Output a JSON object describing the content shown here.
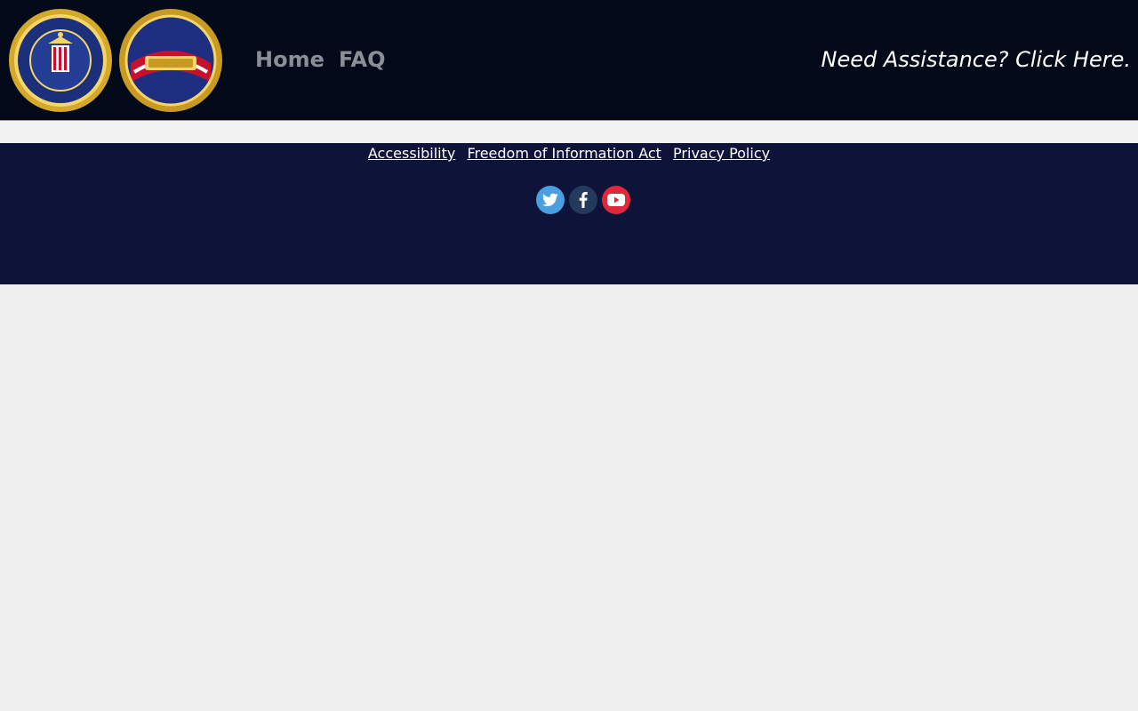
{
  "header": {
    "nav": {
      "home_label": "Home",
      "faq_label": "FAQ"
    },
    "assistance_label": "Need Assistance?  Click Here."
  },
  "footer": {
    "links": {
      "accessibility": "Accessibility",
      "foia": "Freedom of Information Act",
      "privacy": "Privacy Policy"
    },
    "social": [
      "twitter-icon",
      "facebook-icon",
      "youtube-icon"
    ]
  },
  "colors": {
    "header_bg": "#020a1a",
    "footer_bg": "#0e133a",
    "nav_text": "#8a8e96",
    "twitter": "#4a9fe0",
    "facebook": "#233a5c",
    "youtube": "#e0283a",
    "seal_gold": "#d4a82a"
  }
}
